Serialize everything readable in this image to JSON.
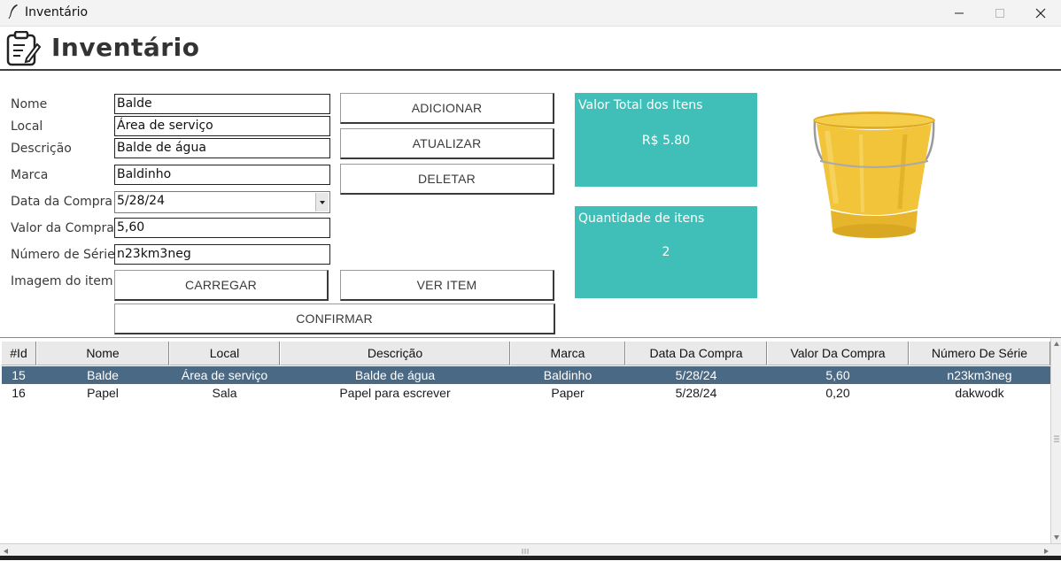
{
  "window": {
    "title": "Inventário",
    "icon": "feather-icon"
  },
  "header": {
    "title": "Inventário",
    "icon": "clipboard-icon"
  },
  "form": {
    "labels": {
      "nome": "Nome",
      "local": "Local",
      "descricao": "Descrição",
      "marca": "Marca",
      "data_compra": "Data da Compra",
      "valor_compra": "Valor da Compra",
      "numero_serie": "Número de Série",
      "imagem": "Imagem do item"
    },
    "values": {
      "nome": "Balde",
      "local": "Área de serviço",
      "descricao": "Balde de água",
      "marca": "Baldinho",
      "data_compra": "5/28/24",
      "valor_compra": "5,60",
      "numero_serie": "n23km3neg"
    }
  },
  "buttons": {
    "adicionar": "ADICIONAR",
    "atualizar": "ATUALIZAR",
    "deletar": "DELETAR",
    "carregar": "CARREGAR",
    "ver_item": "VER ITEM",
    "confirmar": "CONFIRMAR"
  },
  "cards": {
    "total": {
      "caption": "Valor Total dos Itens",
      "value": "R$ 5.80"
    },
    "quantidade": {
      "caption": "Quantidade de itens",
      "value": "2"
    }
  },
  "colors": {
    "card": "#3fbfb8",
    "selected_row": "#4a6984",
    "bucket": "#f2c43a"
  },
  "table": {
    "columns": [
      "#Id",
      "Nome",
      "Local",
      "Descrição",
      "Marca",
      "Data Da Compra",
      "Valor Da Compra",
      "Número De Série"
    ],
    "rows": [
      {
        "cells": [
          "15",
          "Balde",
          "Área de serviço",
          "Balde de água",
          "Baldinho",
          "5/28/24",
          "5,60",
          "n23km3neg"
        ],
        "selected": true
      },
      {
        "cells": [
          "16",
          "Papel",
          "Sala",
          "Papel para escrever",
          "Paper",
          "5/28/24",
          "0,20",
          "dakwodk"
        ],
        "selected": false
      }
    ]
  }
}
